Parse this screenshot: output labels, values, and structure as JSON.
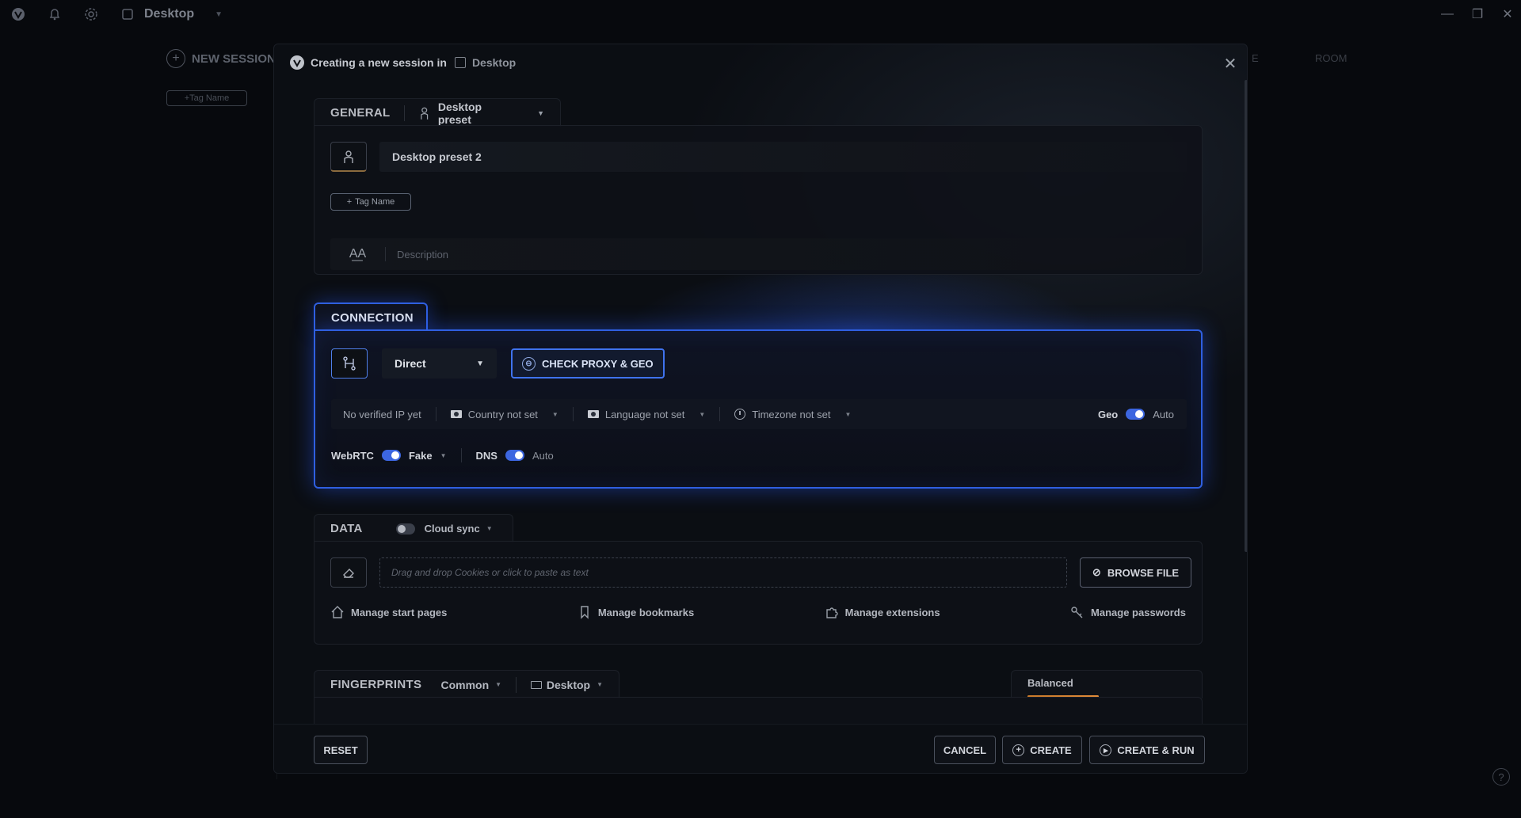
{
  "app": {
    "title": "Desktop",
    "new_session": "NEW SESSION",
    "tag_name": "Tag Name",
    "frag_e": "E",
    "frag_right": "ROOM"
  },
  "modal": {
    "header_prefix": "Creating a new session in",
    "workspace": "Desktop",
    "general": {
      "title": "GENERAL",
      "preset": "Desktop preset",
      "name_value": "Desktop preset 2",
      "tag_button": "Tag Name",
      "description_placeholder": "Description"
    },
    "connection": {
      "title": "CONNECTION",
      "type": "Direct",
      "check_button": "CHECK PROXY & GEO",
      "ip_status": "No verified IP yet",
      "country": "Country not set",
      "language": "Language not set",
      "timezone": "Timezone not set",
      "geo_label": "Geo",
      "geo_value": "Auto",
      "webrtc_label": "WebRTC",
      "webrtc_value": "Fake",
      "dns_label": "DNS",
      "dns_value": "Auto"
    },
    "data": {
      "title": "DATA",
      "cloud_sync": "Cloud sync",
      "drop_placeholder": "Drag and drop Cookies or click to paste as text",
      "browse_button": "BROWSE FILE",
      "links": [
        "Manage start pages",
        "Manage bookmarks",
        "Manage extensions",
        "Manage passwords"
      ]
    },
    "fingerprints": {
      "title": "FINGERPRINTS",
      "mode": "Common",
      "device": "Desktop",
      "profile": "Balanced"
    },
    "footer": {
      "reset": "RESET",
      "cancel": "CANCEL",
      "create": "CREATE",
      "create_run": "CREATE & RUN"
    }
  },
  "colors": {
    "accent": "#2f5fe0",
    "background": "#07090d",
    "balanced_bar": "#e08b3a"
  }
}
